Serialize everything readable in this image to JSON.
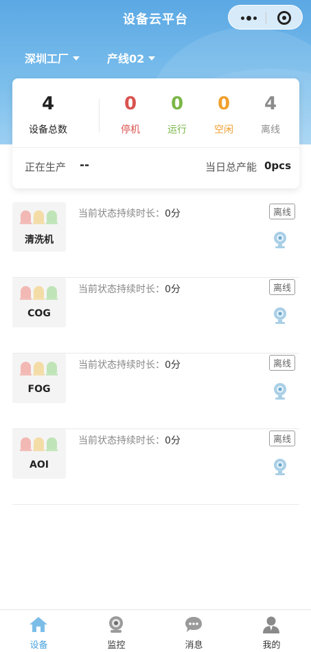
{
  "header": {
    "title": "设备云平台",
    "capsule": {
      "more_icon": "more-dots-icon",
      "close_icon": "target-close-icon"
    }
  },
  "filters": {
    "factory": "深圳工厂",
    "line": "产线02"
  },
  "summary": {
    "total": {
      "value": "4",
      "label": "设备总数"
    },
    "stats": [
      {
        "value": "0",
        "label": "停机",
        "color": "#d9534f"
      },
      {
        "value": "0",
        "label": "运行",
        "color": "#7ab648"
      },
      {
        "value": "0",
        "label": "空闲",
        "color": "#f0a030"
      },
      {
        "value": "4",
        "label": "离线",
        "color": "#8c8c8c"
      }
    ],
    "producing_label": "正在生产",
    "producing_value": "--",
    "daily_output_label": "当日总产能",
    "daily_output_value": "0pcs"
  },
  "devices": [
    {
      "name": "清洗机",
      "duration_label": "当前状态持续时长：",
      "duration_value": "0分",
      "status": "离线"
    },
    {
      "name": "COG",
      "duration_label": "当前状态持续时长：",
      "duration_value": "0分",
      "status": "离线"
    },
    {
      "name": "FOG",
      "duration_label": "当前状态持续时长：",
      "duration_value": "0分",
      "status": "离线"
    },
    {
      "name": "AOI",
      "duration_label": "当前状态持续时长：",
      "duration_value": "0分",
      "status": "离线"
    }
  ],
  "tabbar": {
    "items": [
      {
        "label": "设备",
        "icon": "home-icon",
        "active": true
      },
      {
        "label": "监控",
        "icon": "camera-icon",
        "active": false
      },
      {
        "label": "消息",
        "icon": "chat-icon",
        "active": false
      },
      {
        "label": "我的",
        "icon": "user-icon",
        "active": false
      }
    ],
    "active_color": "#4aa3df"
  }
}
